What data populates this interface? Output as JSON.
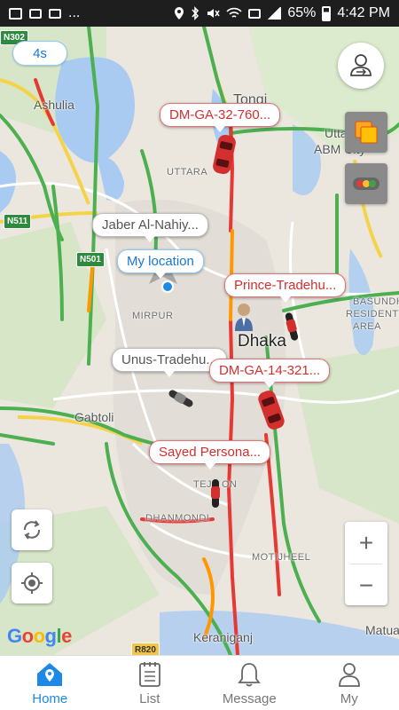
{
  "status_bar": {
    "battery": "65%",
    "time": "4:42 PM",
    "ellipsis": "..."
  },
  "map": {
    "refresh_interval": "4s",
    "places": {
      "n302": "N302",
      "ashulia": "Ashulia",
      "tongi": "Tongi",
      "uttara_ab": "Uttar",
      "abm_city": "ABM City",
      "uttara": "UTTARA",
      "n511": "N511",
      "n501": "N501",
      "mirpur": "MIRPUR",
      "basundhara": "BASUNDHARA",
      "residential_area": "RESIDENTIAL",
      "area": "AREA",
      "dhaka": "Dhaka",
      "gabtoli": "Gabtoli",
      "tejgaon": "TEJ",
      "tejgaon2": "ON",
      "dhanmondi": "DHANMONDI",
      "motijheel": "MOTIJHEEL",
      "keraniganj": "Keraniganj",
      "r820": "R820",
      "matua": "Matua"
    },
    "callouts": {
      "dm_ga_32": "DM-GA-32-760...",
      "jaber": "Jaber Al-Nahiy...",
      "my_location": "My location",
      "prince": "Prince-Tradehu...",
      "unus": "Unus-Tradehu...",
      "dm_ga_14": "DM-GA-14-321...",
      "sayed": "Sayed Persona..."
    },
    "zoom_in": "+",
    "zoom_out": "−",
    "attribution": [
      "G",
      "o",
      "o",
      "g",
      "l",
      "e"
    ]
  },
  "nav": {
    "home": "Home",
    "list": "List",
    "message": "Message",
    "my": "My"
  },
  "colors": {
    "accent": "#1e88e5",
    "vehicle_red": "#d32f2f",
    "traffic_green": "#4caf50",
    "traffic_red": "#e53935"
  }
}
